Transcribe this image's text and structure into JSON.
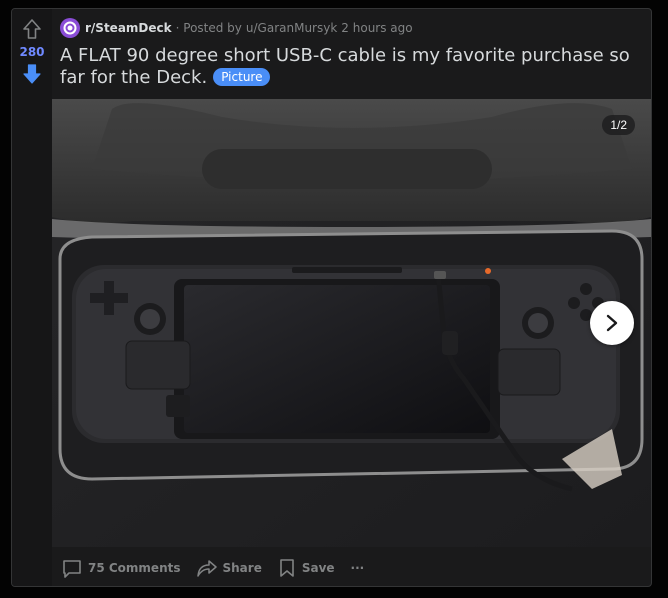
{
  "post": {
    "score": "280",
    "subreddit": "r/SteamDeck",
    "posted_by_prefix": "· Posted by",
    "author": "u/GaranMursyk",
    "time": "2 hours ago",
    "title": "A FLAT 90 degree short USB-C cable is my favorite purchase so far for the Deck.",
    "flair": "Picture"
  },
  "gallery": {
    "counter": "1/2"
  },
  "actions": {
    "comments": "75 Comments",
    "share": "Share",
    "save": "Save",
    "more": "···"
  },
  "colors": {
    "upvote_active": "#4a8ef7",
    "score": "#6f89ff",
    "flair_bg": "#4a8ef7",
    "card_bg": "#1a1a1b",
    "page_bg": "#030303"
  },
  "icons": [
    "upvote-arrow-icon",
    "downvote-arrow-icon",
    "subreddit-icon",
    "next-arrow-icon",
    "comment-icon",
    "share-icon",
    "bookmark-icon",
    "more-icon"
  ]
}
